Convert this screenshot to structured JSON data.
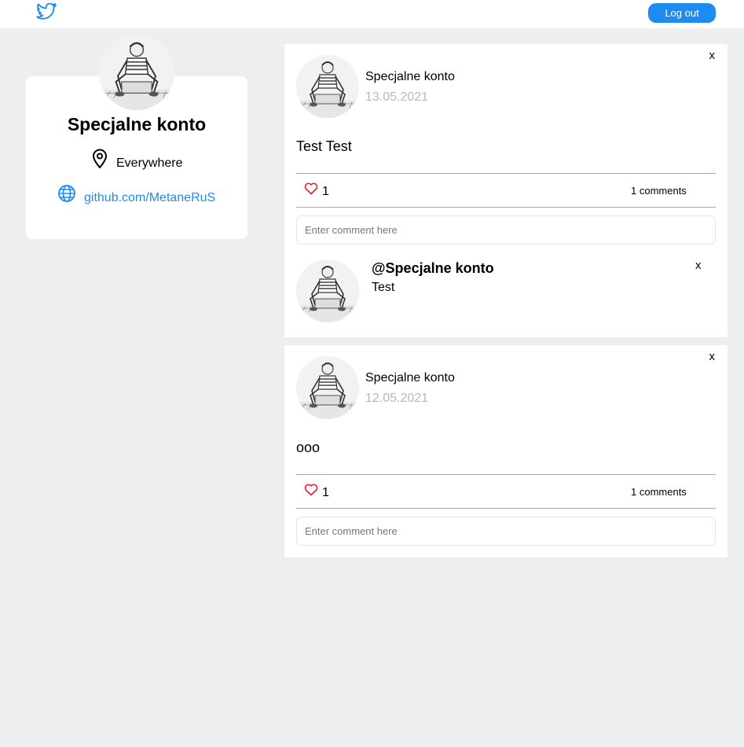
{
  "header": {
    "logo_icon": "twitter-bird-icon",
    "logout_label": "Log out",
    "accent_color": "#1d8cf0"
  },
  "profile": {
    "name": "Specjalne konto",
    "location": "Everywhere",
    "website": "github.com/MetaneRuS",
    "location_icon": "map-pin-icon",
    "website_icon": "globe-icon"
  },
  "posts": [
    {
      "author": "Specjalne konto",
      "date": "13.05.2021",
      "text": "Test Test",
      "likes": "1",
      "comments_label": "1 comments",
      "close_label": "x",
      "comment_placeholder": "Enter comment here",
      "comments": [
        {
          "author": "@Specjalne konto",
          "text": "Test",
          "close_label": "x"
        }
      ]
    },
    {
      "author": "Specjalne konto",
      "date": "12.05.2021",
      "text": "ooo",
      "likes": "1",
      "comments_label": "1 comments",
      "close_label": "x",
      "comment_placeholder": "Enter comment here",
      "comments": []
    }
  ]
}
